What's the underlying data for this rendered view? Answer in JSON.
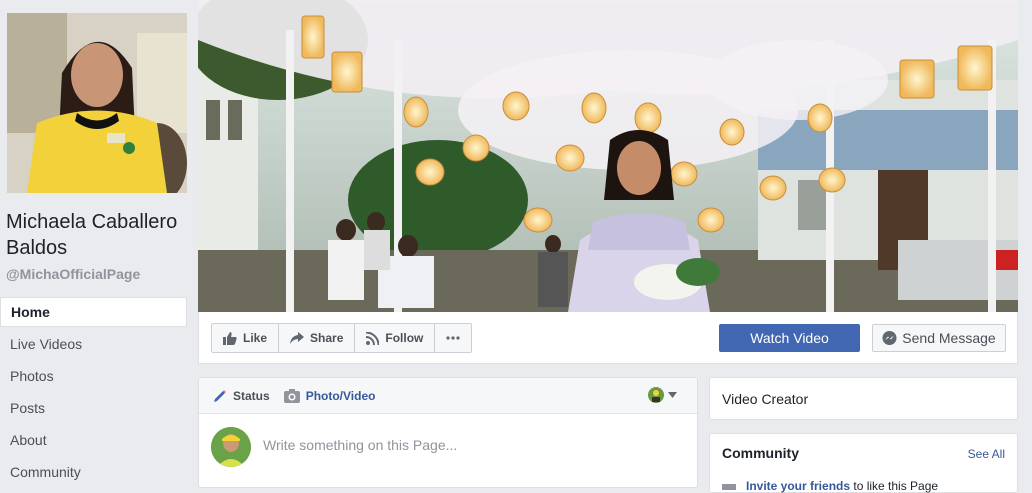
{
  "page": {
    "name": "Michaela Caballero Baldos",
    "handle": "@MichaOfficialPage"
  },
  "nav": {
    "items": [
      {
        "label": "Home",
        "active": true
      },
      {
        "label": "Live Videos"
      },
      {
        "label": "Photos"
      },
      {
        "label": "Posts"
      },
      {
        "label": "About"
      },
      {
        "label": "Community"
      }
    ]
  },
  "actions": {
    "like": "Like",
    "share": "Share",
    "follow": "Follow",
    "watch_video": "Watch Video",
    "send_message": "Send Message"
  },
  "composer": {
    "status_tab": "Status",
    "photo_tab": "Photo/Video",
    "placeholder": "Write something on this Page..."
  },
  "sidebar_right": {
    "category": "Video Creator",
    "community_title": "Community",
    "see_all": "See All",
    "invite_link": "Invite your friends",
    "invite_rest": " to like this Page"
  },
  "colors": {
    "brand_blue": "#4267b2",
    "link_blue": "#365899",
    "background": "#e9ebee"
  }
}
